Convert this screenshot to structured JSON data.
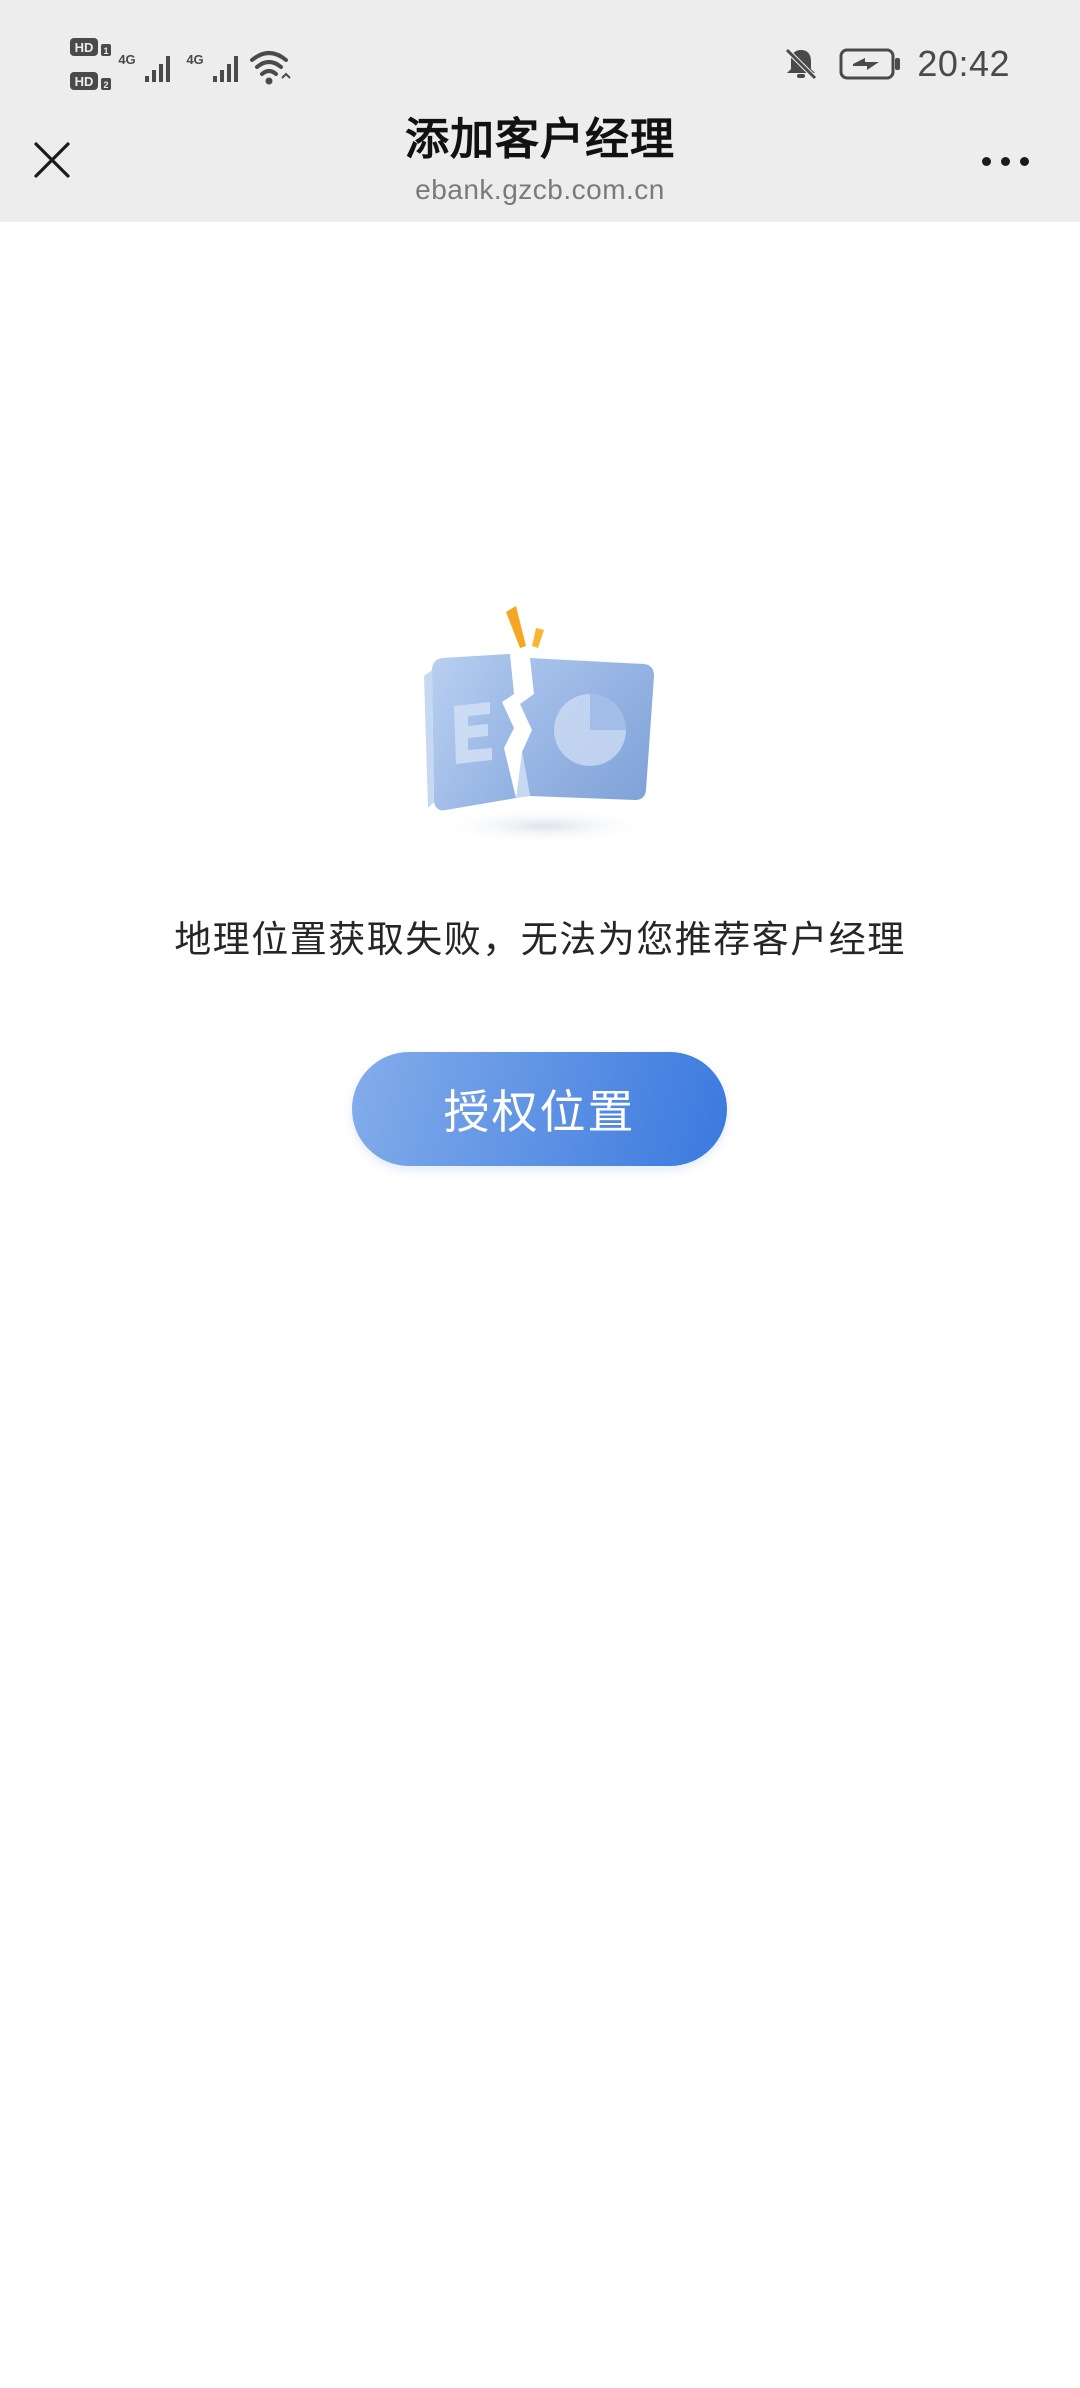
{
  "status_bar": {
    "sim1_label": "HD",
    "sim1_index": "1",
    "sim2_label": "HD",
    "sim2_index": "2",
    "network1": "4G",
    "network2": "4G",
    "time": "20:42",
    "icons": [
      "signal-icon",
      "wifi-icon",
      "bell-off-icon",
      "battery-charging-icon"
    ]
  },
  "header": {
    "title": "添加客户经理",
    "subtitle": "ebank.gzcb.com.cn",
    "close_icon": "close-icon",
    "more_icon": "more-icon"
  },
  "main": {
    "illustration_icon": "broken-document-icon",
    "message": "地理位置获取失败，无法为您推荐客户经理",
    "button_label": "授权位置"
  },
  "colors": {
    "chrome_bg": "#ededed",
    "button_start": "#84adea",
    "button_end": "#3a79df",
    "accent_spark": "#f5a623"
  }
}
